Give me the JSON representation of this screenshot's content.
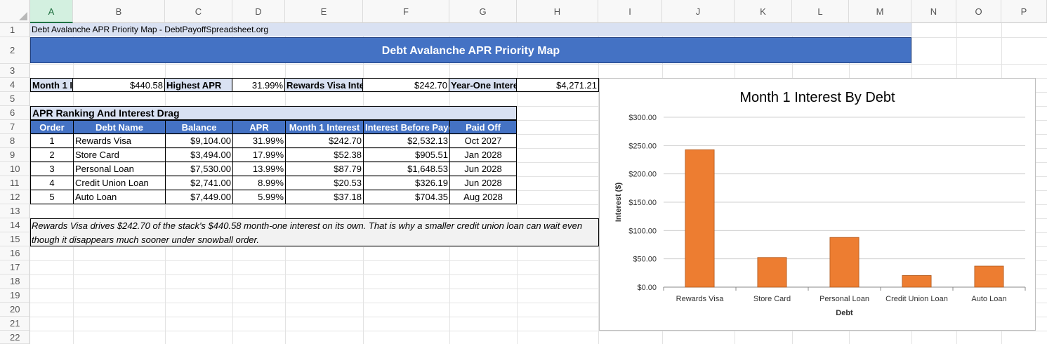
{
  "columns": [
    "A",
    "B",
    "C",
    "D",
    "E",
    "F",
    "G",
    "H",
    "I",
    "J",
    "K",
    "L",
    "M",
    "N",
    "O",
    "P"
  ],
  "rows": [
    "1",
    "2",
    "3",
    "4",
    "5",
    "6",
    "7",
    "8",
    "9",
    "10",
    "11",
    "12",
    "13",
    "14",
    "15",
    "16",
    "17",
    "18",
    "19",
    "20",
    "21",
    "22"
  ],
  "sheet": {
    "a1_text": "Debt Avalanche APR Priority Map - DebtPayoffSpreadsheet.org",
    "banner_title": "Debt Avalanche APR Priority Map",
    "kpis": [
      {
        "label": "Month 1 I",
        "value": "$440.58"
      },
      {
        "label": "Highest APR",
        "value": "31.99%"
      },
      {
        "label": "Rewards Visa Inte",
        "value": "$242.70"
      },
      {
        "label": "Year-One Intere",
        "value": "$4,271.21"
      }
    ],
    "section_title": "APR Ranking And Interest Drag",
    "table_headers": [
      "Order",
      "Debt Name",
      "Balance",
      "APR",
      "Month 1 Interest",
      "Interest Before Payof",
      "Paid Off"
    ],
    "table_rows": [
      [
        "1",
        "Rewards Visa",
        "$9,104.00",
        "31.99%",
        "$242.70",
        "$2,532.13",
        "Oct 2027"
      ],
      [
        "2",
        "Store Card",
        "$3,494.00",
        "17.99%",
        "$52.38",
        "$905.51",
        "Jan 2028"
      ],
      [
        "3",
        "Personal Loan",
        "$7,530.00",
        "13.99%",
        "$87.79",
        "$1,648.53",
        "Jun 2028"
      ],
      [
        "4",
        "Credit Union Loan",
        "$2,741.00",
        "8.99%",
        "$20.53",
        "$326.19",
        "Jun 2028"
      ],
      [
        "5",
        "Auto Loan",
        "$7,449.00",
        "5.99%",
        "$37.18",
        "$704.35",
        "Aug 2028"
      ]
    ],
    "note_line1": "Rewards Visa drives $242.70 of the stack's $440.58 month-one interest on its own. That is why a smaller credit union loan can wait even",
    "note_line2": "though it disappears much sooner under snowball order."
  },
  "colors": {
    "accent": "#4472c4",
    "light": "#d9e1f2",
    "bar": "#ed7d31",
    "bar_edge": "#b05a1f"
  },
  "chart_data": {
    "type": "bar",
    "title": "Month 1 Interest By Debt",
    "xlabel": "Debt",
    "ylabel": "Interest ($)",
    "categories": [
      "Rewards Visa",
      "Store Card",
      "Personal Loan",
      "Credit Union Loan",
      "Auto Loan"
    ],
    "values": [
      242.7,
      52.38,
      87.79,
      20.53,
      37.18
    ],
    "ylim": [
      0,
      300
    ],
    "yticks": [
      "$0.00",
      "$50.00",
      "$100.00",
      "$150.00",
      "$200.00",
      "$250.00",
      "$300.00"
    ],
    "grid": true,
    "legend": "none"
  }
}
